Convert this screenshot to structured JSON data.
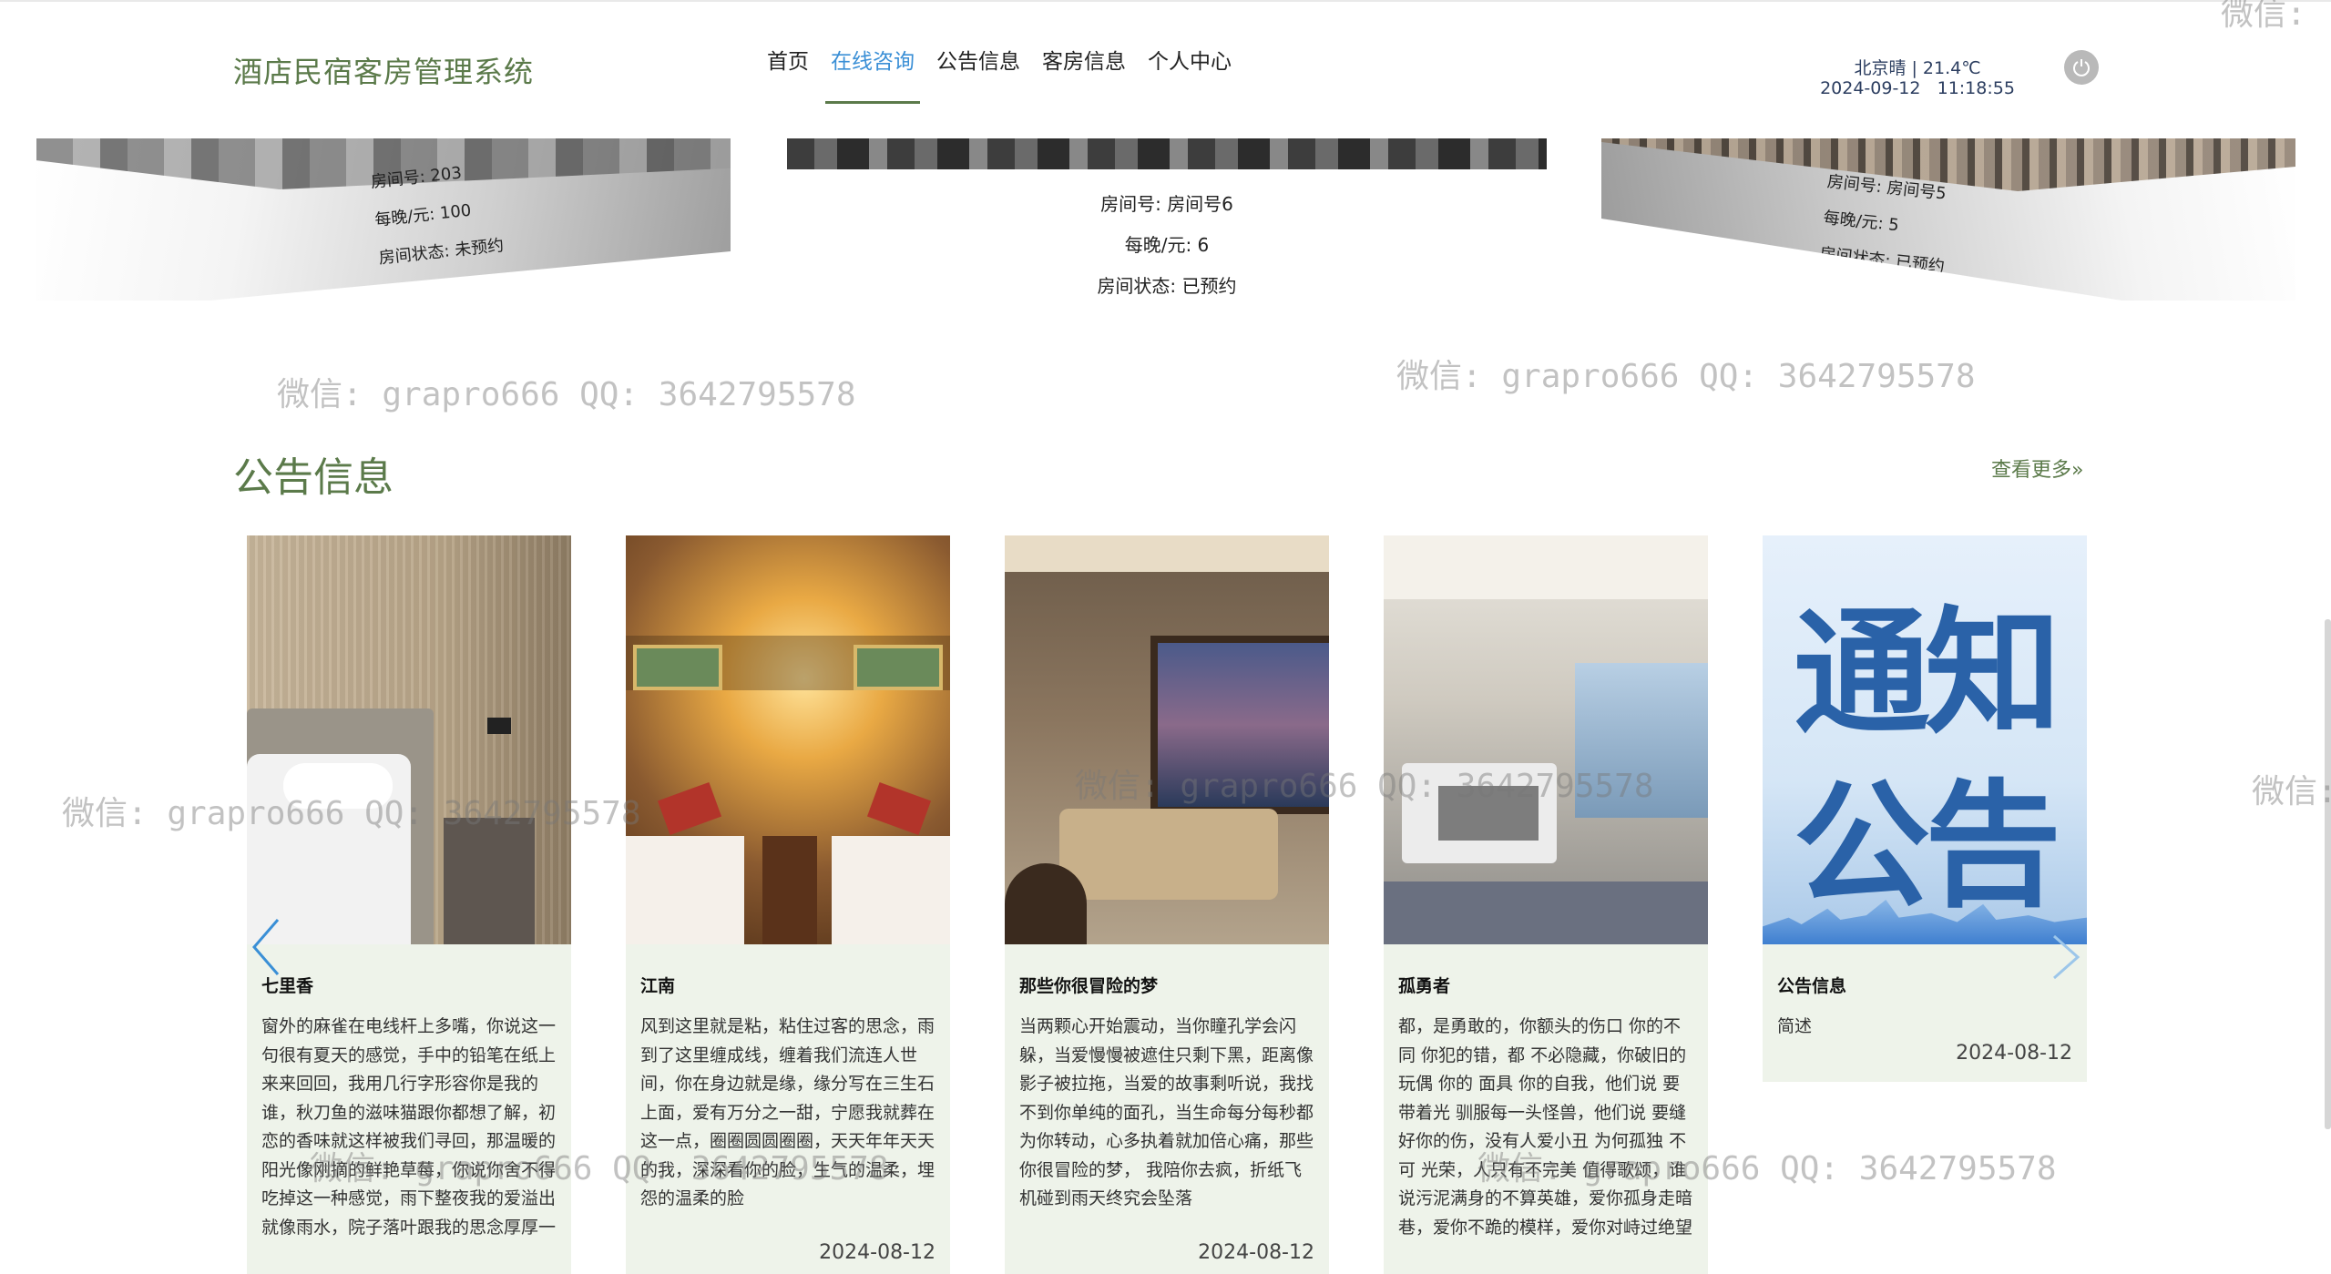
{
  "header": {
    "brand": "酒店民宿客房管理系统",
    "nav": [
      "首页",
      "在线咨询",
      "公告信息",
      "客房信息",
      "个人中心"
    ],
    "active_nav_index": 1,
    "weather_line": "北京晴 | 21.4℃",
    "datetime": "2024-09-12   11:18:55",
    "power_icon": "power-icon"
  },
  "rooms": [
    {
      "number_label": "房间号:",
      "number": "203",
      "price_label": "每晚/元:",
      "price": "100",
      "status_label": "房间状态:",
      "status": "未预约"
    },
    {
      "number_label": "房间号:",
      "number": "房间号6",
      "price_label": "每晚/元:",
      "price": "6",
      "status_label": "房间状态:",
      "status": "已预约"
    },
    {
      "number_label": "房间号:",
      "number": "房间号5",
      "price_label": "每晚/元:",
      "price": "5",
      "status_label": "房间状态:",
      "status": "已预约"
    }
  ],
  "watermark": "微信: grapro666 QQ: 3642795578",
  "watermark_partial": "微信:",
  "announcements": {
    "title": "公告信息",
    "more": "查看更多»",
    "notice_image_text": [
      "通知",
      "公告"
    ],
    "items": [
      {
        "title": "七里香",
        "desc": "窗外的麻雀在电线杆上多嘴，你说这一句很有夏天的感觉，手中的铅笔在纸上来来回回，我用几行字形容你是我的谁，秋刀鱼的滋味猫跟你都想了解，初恋的香味就这样被我们寻回，那温暖的阳光像刚摘的鲜艳草莓，你说你舍不得吃掉这一种感觉，雨下整夜我的爱溢出就像雨水，院子落叶跟我的思念厚厚一",
        "date": ""
      },
      {
        "title": "江南",
        "desc": "风到这里就是粘，粘住过客的思念，雨到了这里缠成线，缠着我们流连人世间，你在身边就是缘，缘分写在三生石上面，爱有万分之一甜，宁愿我就葬在这一点，圈圈圆圆圈圈，天天年年天天的我，深深看你的脸，生气的温柔，埋怨的温柔的脸",
        "date": "2024-08-12"
      },
      {
        "title": "那些你很冒险的梦",
        "desc": "当两颗心开始震动，当你瞳孔学会闪躲，当爱慢慢被遮住只剩下黑，距离像影子被拉拖，当爱的故事剩听说，我找不到你单纯的面孔，当生命每分每秒都为你转动，心多执着就加倍心痛，那些你很冒险的梦， 我陪你去疯，折纸飞机碰到雨天终究会坠落",
        "date": "2024-08-12"
      },
      {
        "title": "孤勇者",
        "desc": "都，是勇敢的，你额头的伤口 你的不同 你犯的错，都 不必隐藏，你破旧的玩偶 你的 面具 你的自我，他们说 要带着光 驯服每一头怪兽，他们说 要缝好你的伤，没有人爱小丑 为何孤独 不可 光荣，人只有不完美 值得歌颂，谁说污泥满身的不算英雄，爱你孤身走暗巷，爱你不跪的模样，爱你对峙过绝望",
        "date": ""
      },
      {
        "title": "公告信息",
        "desc": "简述",
        "date": "2024-08-12"
      }
    ]
  }
}
